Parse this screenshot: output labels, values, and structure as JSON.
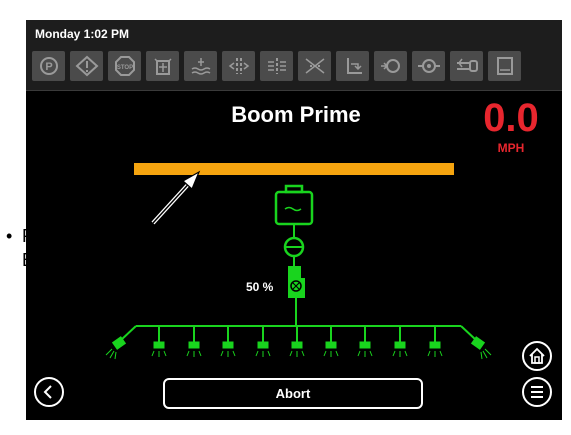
{
  "status": {
    "time": "Monday 1:02 PM"
  },
  "toolbar": {
    "icons": [
      "parking-icon",
      "warning-icon",
      "stop-icon",
      "tank-fill-icon",
      "water-level-icon",
      "section-left-icon",
      "section-flow-icon",
      "section-off-icon",
      "boom-height-icon",
      "pump-icon",
      "flow-meter-icon",
      "hitch-icon",
      "tank-empty-icon"
    ]
  },
  "screen": {
    "title": "Boom Prime"
  },
  "speed": {
    "value": "0.0",
    "unit": "MPH"
  },
  "progress": {
    "value": 1.0,
    "label": "50 %"
  },
  "buttons": {
    "abort": "Abort"
  },
  "annotation": {
    "line1": "Progress",
    "line2": "Bar"
  },
  "colors": {
    "accent_green": "#19d41e",
    "progress_orange": "#f5a40f",
    "speed_red": "#e8262e"
  }
}
